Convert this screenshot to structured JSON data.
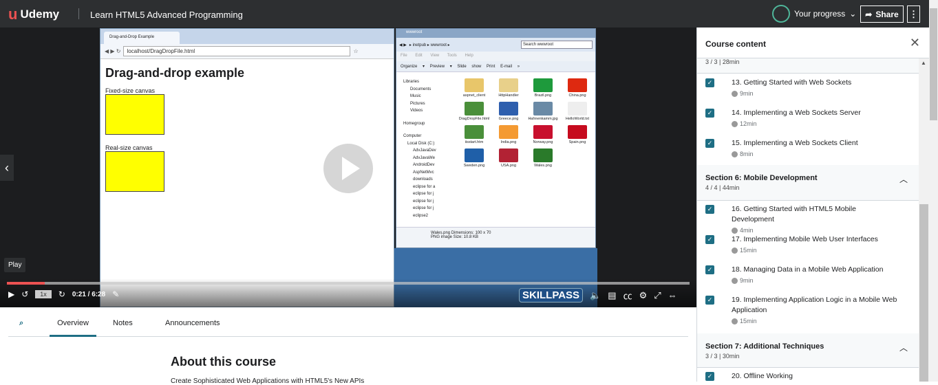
{
  "header": {
    "logo": "Udemy",
    "title": "Learn HTML5 Advanced Programming",
    "progress": "Your progress",
    "share": "Share",
    "more": "⋮"
  },
  "video": {
    "browser": {
      "tab": "Drag-and-Drop Example",
      "url": "localhost/DragDropFile.html",
      "heading": "Drag-and-drop example",
      "fixed": "Fixed-size canvas",
      "real": "Real-size canvas"
    },
    "explorer": {
      "title": "wwwroot",
      "path": "▸ inetpub ▸ wwwroot ▸",
      "search": "Search wwwroot",
      "menu": "File Edit View Tools Help",
      "toolbar": "Organize ▾  Preview ▾  Slide show  Print  E-mail  »",
      "tree": [
        "Libraries",
        "Documents",
        "Music",
        "Pictures",
        "Videos",
        "Homegroup",
        "Computer",
        "Local Disk (C:)",
        "AdvJavaDev",
        "AdvJavaWe",
        "AndroidDev",
        "AspNetMvc",
        "downloads",
        "eclipse for a",
        "eclipse for j",
        "eclipse for j",
        "eclipse for j",
        "eclipse2"
      ],
      "files": [
        {
          "name": "aspnet_client",
          "color": "#e8c66a"
        },
        {
          "name": "HttpHandler",
          "color": "#e8d08a"
        },
        {
          "name": "Brazil.png",
          "color": "#1e9a3c"
        },
        {
          "name": "China.png",
          "color": "#de2910"
        },
        {
          "name": "DragDropFile.html",
          "color": "#4a8f3a"
        },
        {
          "name": "Greece.png",
          "color": "#2e5fae"
        },
        {
          "name": "Hahnenkamm.jpg",
          "color": "#6a8aa6"
        },
        {
          "name": "HelloWorld.txt",
          "color": "#eeeeee"
        },
        {
          "name": "iisstart.htm",
          "color": "#4a8f3a"
        },
        {
          "name": "India.png",
          "color": "#f49a32"
        },
        {
          "name": "Norway.png",
          "color": "#c8102e"
        },
        {
          "name": "Spain.png",
          "color": "#c60b1e"
        },
        {
          "name": "Sweden.png",
          "color": "#1f5fa8"
        },
        {
          "name": "USA.png",
          "color": "#b22234"
        },
        {
          "name": "Wales.png",
          "color": "#2a7a2a"
        }
      ],
      "info_name": "Wales.png  Dimensions:  100 x 70",
      "info_type": "PNG image        Size:  10.8 KB"
    },
    "tooltip": "Play",
    "progress_fraction": 0.055,
    "rate": "1x",
    "time": "0:21 / 6:28",
    "watermark": "SKILLPASS"
  },
  "tabs": [
    "Overview",
    "Notes",
    "Announcements"
  ],
  "about": {
    "title": "About this course",
    "desc": "Create Sophisticated Web Applications with HTML5's New APIs"
  },
  "sidebar": {
    "title": "Course content",
    "sec5_meta": "3 / 3 | 28min",
    "lessons_a": [
      {
        "name": "13. Getting Started with Web Sockets",
        "dur": "9min"
      },
      {
        "name": "14. Implementing a Web Sockets Server",
        "dur": "12min"
      },
      {
        "name": "15. Implementing a Web Sockets Client",
        "dur": "8min"
      }
    ],
    "sec6": {
      "title": "Section 6: Mobile Development",
      "meta": "4 / 4 | 44min"
    },
    "lessons_b": [
      {
        "name": "16. Getting Started with HTML5 Mobile Development",
        "dur": "4min"
      },
      {
        "name": "17. Implementing Mobile Web User Interfaces",
        "dur": "15min"
      },
      {
        "name": "18. Managing Data in a Mobile Web Application",
        "dur": "9min"
      },
      {
        "name": "19. Implementing Application Logic in a Mobile Web Application",
        "dur": "15min"
      }
    ],
    "sec7": {
      "title": "Section 7: Additional Techniques",
      "meta": "3 / 3 | 30min"
    },
    "lessons_c": [
      {
        "name": "20. Offline Working",
        "dur": ""
      }
    ]
  }
}
